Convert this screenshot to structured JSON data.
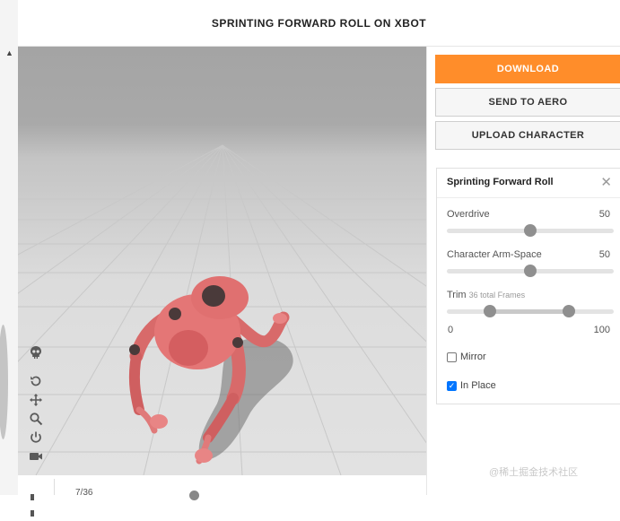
{
  "header": {
    "title": "SPRINTING FORWARD ROLL ON XBOT"
  },
  "actions": {
    "download_label": "DOWNLOAD",
    "send_label": "SEND TO AERO",
    "upload_label": "UPLOAD CHARACTER",
    "accent_color": "#ff8d2a"
  },
  "animation_card": {
    "title": "Sprinting Forward Roll",
    "overdrive": {
      "label": "Overdrive",
      "value": "50",
      "level": 0.5
    },
    "arm_space": {
      "label": "Character Arm-Space",
      "value": "50",
      "level": 0.5
    },
    "trim": {
      "label": "Trim",
      "frames_note": "36 total Frames",
      "min_label": "0",
      "max_label": "100",
      "start": 0.26,
      "end": 0.73
    },
    "mirror": {
      "label": "Mirror",
      "checked": false
    },
    "in_place": {
      "label": "In Place",
      "checked": true
    }
  },
  "viewport_tools": [
    "skull-icon",
    "reset-icon",
    "pan-icon",
    "zoom-icon",
    "power-icon",
    "camera-icon"
  ],
  "timeline": {
    "frame": "7/36"
  },
  "watermark": "@稀土掘金技术社区"
}
